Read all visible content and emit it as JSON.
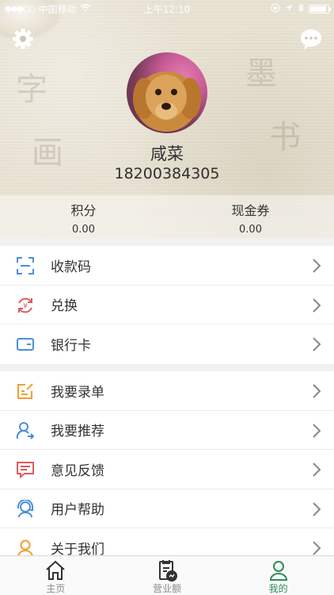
{
  "status_bar": {
    "carrier": "中国移动",
    "time": "上午12:10"
  },
  "profile": {
    "username": "咸菜",
    "phone": "18200384305"
  },
  "stats": [
    {
      "label": "积分",
      "value": "0.00"
    },
    {
      "label": "现金券",
      "value": "0.00"
    }
  ],
  "menu_group_1": [
    {
      "label": "收款码",
      "icon": "scan-icon"
    },
    {
      "label": "兑换",
      "icon": "exchange-icon"
    },
    {
      "label": "银行卡",
      "icon": "bank-card-icon"
    }
  ],
  "menu_group_2": [
    {
      "label": "我要录单",
      "icon": "edit-order-icon"
    },
    {
      "label": "我要推荐",
      "icon": "recommend-icon"
    },
    {
      "label": "意见反馈",
      "icon": "feedback-icon"
    },
    {
      "label": "用户帮助",
      "icon": "help-icon"
    },
    {
      "label": "关于我们",
      "icon": "about-icon"
    }
  ],
  "tabs": [
    {
      "label": "主页",
      "icon": "home-icon",
      "active": false
    },
    {
      "label": "营业额",
      "icon": "revenue-icon",
      "active": false
    },
    {
      "label": "我的",
      "icon": "profile-icon",
      "active": true
    }
  ],
  "colors": {
    "accent_green": "#2e8b57",
    "icon_blue": "#4a90d9",
    "icon_red": "#e05a5a",
    "icon_orange": "#f0a030"
  }
}
